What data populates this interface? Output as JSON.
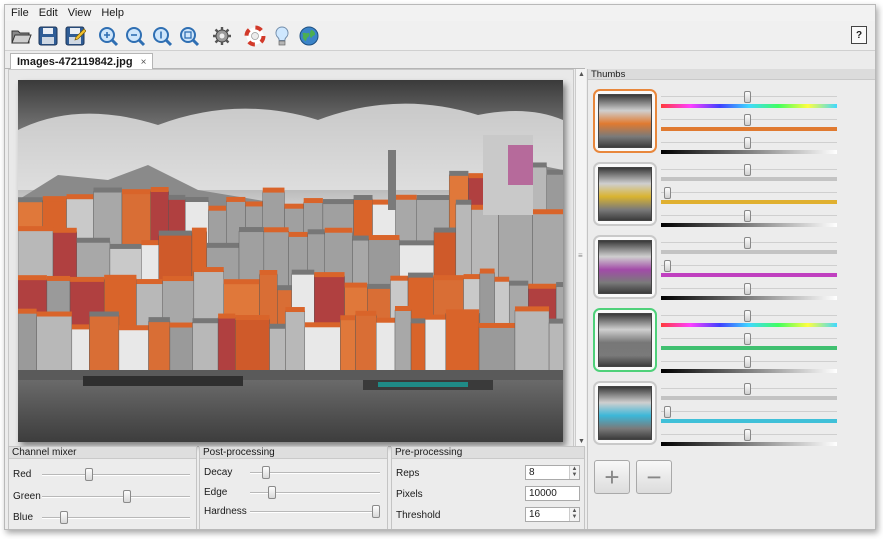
{
  "menu": [
    "File",
    "Edit",
    "View",
    "Help"
  ],
  "toolbar": {
    "buttons": [
      {
        "name": "open-folder-icon"
      },
      {
        "name": "save-icon"
      },
      {
        "name": "save-as-icon"
      },
      {
        "name": "zoom-in-icon"
      },
      {
        "name": "zoom-out-icon"
      },
      {
        "name": "zoom-actual-icon"
      },
      {
        "name": "zoom-fit-icon"
      },
      {
        "name": "settings-gear-icon"
      },
      {
        "name": "lifebuoy-icon"
      },
      {
        "name": "lightbulb-icon"
      },
      {
        "name": "globe-icon"
      }
    ],
    "help_label": "?"
  },
  "tab": {
    "label": "Images-472119842.jpg",
    "close": "×"
  },
  "viewer": {
    "scroll_up": "▲",
    "scroll_down": "▼",
    "grip": "≡"
  },
  "channel_mixer": {
    "title": "Channel mixer",
    "rows": [
      {
        "label": "Red",
        "value": 0.31
      },
      {
        "label": "Green",
        "value": 0.58
      },
      {
        "label": "Blue",
        "value": 0.13
      }
    ]
  },
  "post_processing": {
    "title": "Post-processing",
    "rows": [
      {
        "label": "Decay",
        "value": 0.1
      },
      {
        "label": "Edge",
        "value": 0.15
      },
      {
        "label": "Hardness",
        "value": 1.0
      }
    ]
  },
  "pre_processing": {
    "title": "Pre-processing",
    "rows": [
      {
        "label": "Reps",
        "value": "8"
      },
      {
        "label": "Pixels",
        "value": "10000"
      },
      {
        "label": "Threshold",
        "value": "16"
      }
    ],
    "spin_up": "▲",
    "spin_down": "▼"
  },
  "thumbs": {
    "title": "Thumbs",
    "items": [
      {
        "border": "#e8873c",
        "tint": "#e07a30",
        "sliders": [
          0.49,
          0.49,
          0.49
        ],
        "bars": [
          "rainbow",
          "#e07a30",
          "bw"
        ]
      },
      {
        "border": "#c9c9c9",
        "tint": "#d9b430",
        "sliders": [
          0.49,
          0.02,
          0.49
        ],
        "bars": [
          "grey",
          "#e0b030",
          "bw"
        ]
      },
      {
        "border": "#c9c9c9",
        "tint": "#a24ba8",
        "sliders": [
          0.49,
          0.02,
          0.49
        ],
        "bars": [
          "grey",
          "#c040c0",
          "bw"
        ]
      },
      {
        "border": "#4fd17a",
        "tint": "#777777",
        "sliders": [
          0.49,
          0.49,
          0.49
        ],
        "bars": [
          "rainbow",
          "#40c070",
          "bw"
        ]
      },
      {
        "border": "#c9c9c9",
        "tint": "#3cb7d8",
        "sliders": [
          0.49,
          0.02,
          0.49
        ],
        "bars": [
          "grey",
          "#40c0d8",
          "bw"
        ]
      }
    ],
    "add_label": "+",
    "remove_label": "−"
  },
  "colors": {
    "accent_orange": "#e8873c",
    "accent_green": "#4fd17a"
  }
}
